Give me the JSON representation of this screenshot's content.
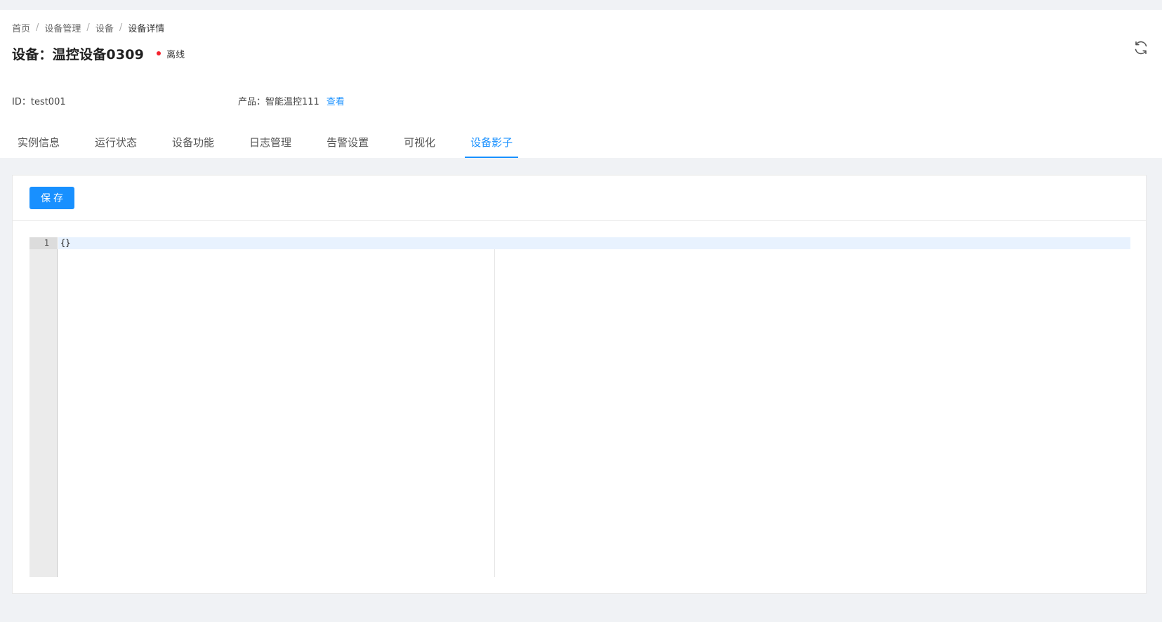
{
  "breadcrumb": {
    "items": [
      "首页",
      "设备管理",
      "设备",
      "设备详情"
    ],
    "separator": "/"
  },
  "device": {
    "title": "设备：温控设备0309",
    "status_label": "离线",
    "status_color": "#f5222d",
    "id_text": "ID：test001",
    "product_label": "产品：智能温控111",
    "view_link": "查看"
  },
  "icons": {
    "refresh": "refresh-icon"
  },
  "tabs": [
    {
      "label": "实例信息",
      "active": false
    },
    {
      "label": "运行状态",
      "active": false
    },
    {
      "label": "设备功能",
      "active": false
    },
    {
      "label": "日志管理",
      "active": false
    },
    {
      "label": "告警设置",
      "active": false
    },
    {
      "label": "可视化",
      "active": false
    },
    {
      "label": "设备影子",
      "active": true
    }
  ],
  "toolbar": {
    "save_label": "保存"
  },
  "editor": {
    "line_number": "1",
    "content": "{}"
  },
  "colors": {
    "accent": "#1890ff",
    "page_bg": "#f0f2f5"
  }
}
